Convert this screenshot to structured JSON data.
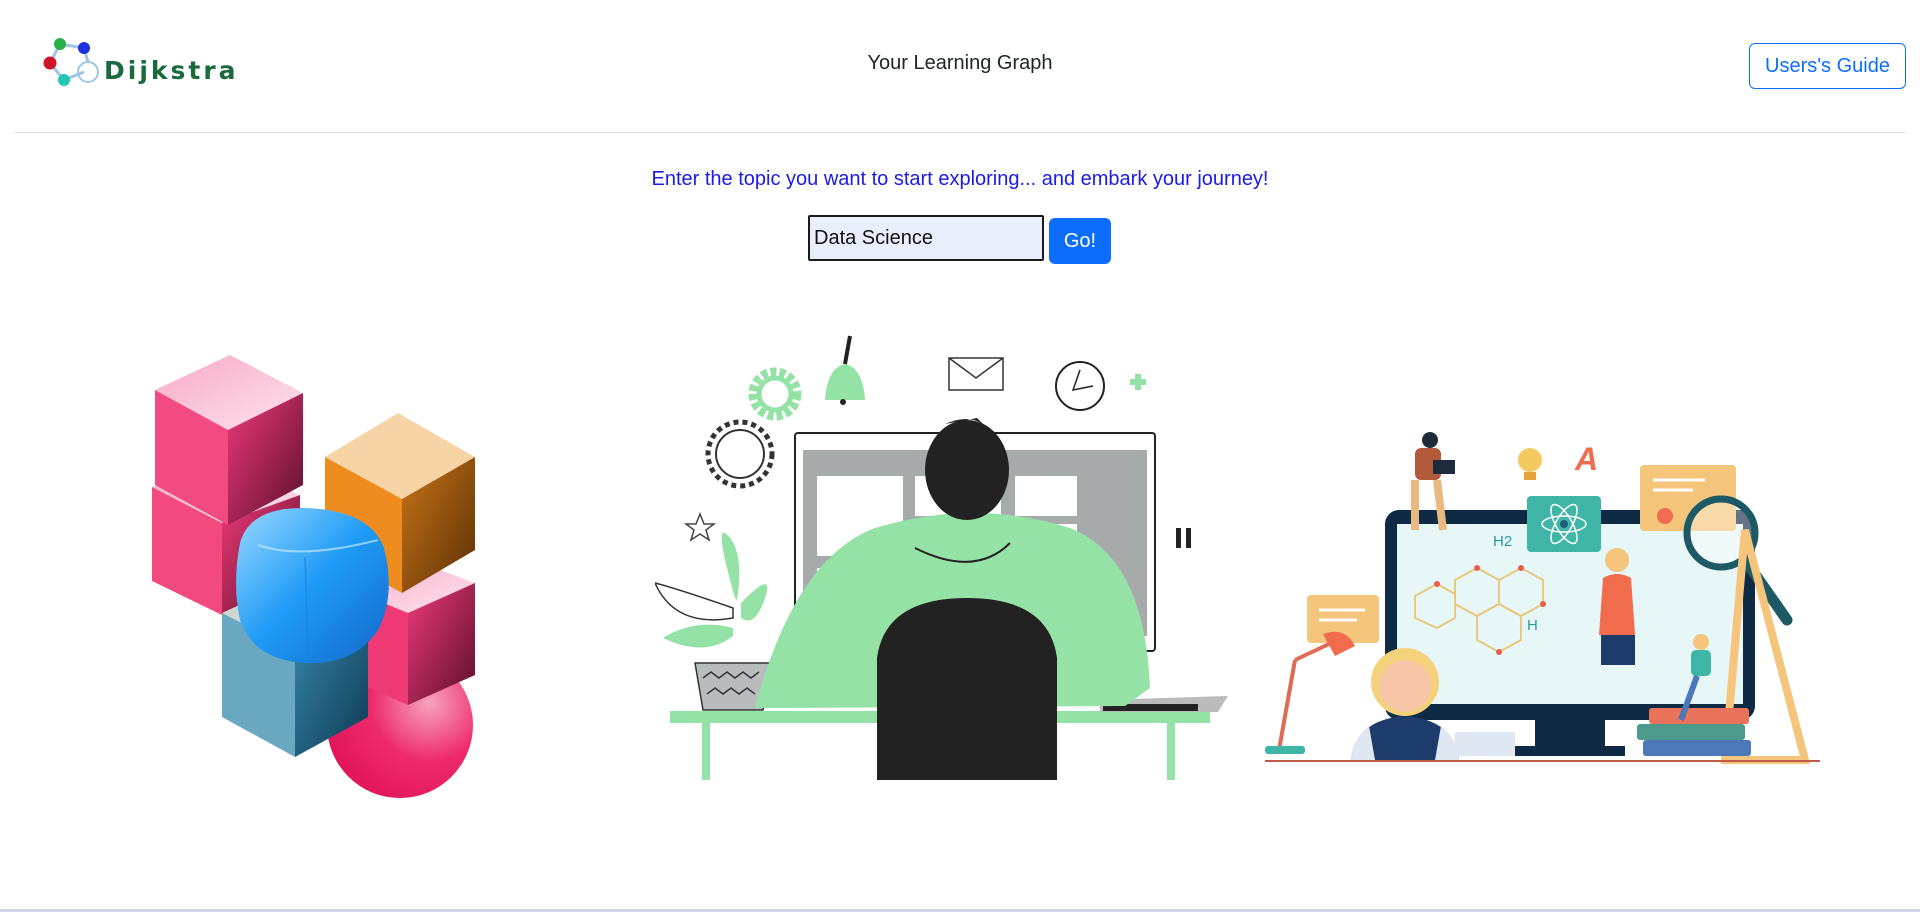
{
  "header": {
    "logo_text": "Dijkstra",
    "title": "Your Learning Graph",
    "guide_label": "Users's Guide"
  },
  "search": {
    "prompt": "Enter the topic you want to start exploring... and embark your journey!",
    "value": "Data Science",
    "go_label": "Go!"
  },
  "illustrations": {
    "right": {
      "h2_label": "H2",
      "h_label": "H",
      "a_label": "A"
    }
  },
  "colors": {
    "brand_green": "#1a6a3e",
    "primary": "#0d6efd",
    "prompt_blue": "#1a1aee",
    "illustration_green": "#95e2a6"
  }
}
